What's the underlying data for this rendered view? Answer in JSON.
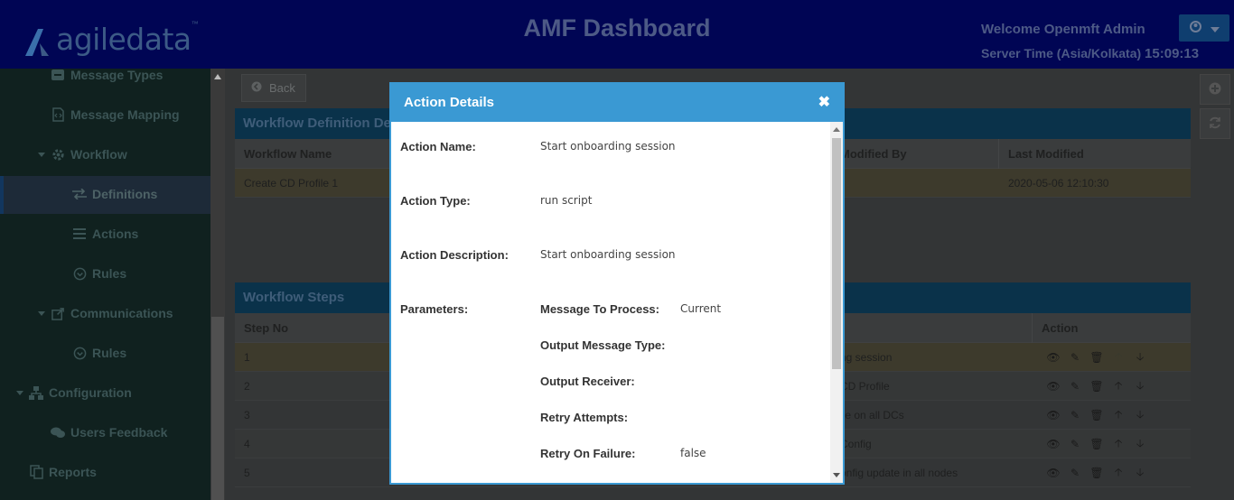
{
  "header": {
    "logo_text": "agiledata",
    "logo_tm": "™",
    "title": "AMF Dashboard",
    "welcome": "Welcome Openmft Admin",
    "server_time_label": "Server Time (Asia/Kolkata)",
    "server_time": "15:09:13",
    "user_icon": "user-circle-icon",
    "dropdown_icon": "caret-down-icon"
  },
  "sidebar": {
    "items": [
      {
        "label": "Message Types",
        "icon": "envelope-icon"
      },
      {
        "label": "Message Mapping",
        "icon": "code-file-icon"
      },
      {
        "label": "Workflow",
        "icon": "gear-icon"
      },
      {
        "label": "Definitions",
        "icon": "exchange-icon",
        "active": true
      },
      {
        "label": "Actions",
        "icon": "list-icon"
      },
      {
        "label": "Rules",
        "icon": "circle-arrow-icon"
      },
      {
        "label": "Communications",
        "icon": "share-icon"
      },
      {
        "label": "Rules",
        "icon": "circle-arrow-icon"
      },
      {
        "label": "Configuration",
        "icon": "sitemap-icon"
      },
      {
        "label": "Users Feedback",
        "icon": "comments-icon"
      },
      {
        "label": "Reports",
        "icon": "copy-icon"
      }
    ]
  },
  "main": {
    "back_label": "Back",
    "definition_panel_title": "Workflow Definition Details",
    "definition_headers": {
      "name": "Workflow Name",
      "modified_by": "Modified By",
      "last_modified": "Last Modified"
    },
    "definition_row": {
      "name": "Create CD Profile 1",
      "last_modified": "2020-05-06 12:10:30"
    },
    "steps_panel_title": "Workflow Steps",
    "steps_headers": {
      "step_no": "Step No",
      "action": "Action"
    },
    "steps": [
      {
        "no": "1",
        "desc_fragment": "ng session"
      },
      {
        "no": "2",
        "desc_fragment": "CD Profile"
      },
      {
        "no": "3",
        "desc_fragment": "ile on all DCs"
      },
      {
        "no": "4",
        "desc_fragment": "Config"
      },
      {
        "no": "5",
        "desc_fragment": "onfig update in all nodes"
      }
    ]
  },
  "modal": {
    "title": "Action Details",
    "close_symbol": "✖",
    "action_name_label": "Action Name:",
    "action_name": "Start onboarding session",
    "action_type_label": "Action Type:",
    "action_type": "run script",
    "action_desc_label": "Action Description:",
    "action_desc": "Start onboarding session",
    "parameters_label": "Parameters:",
    "parameters": [
      {
        "label": "Message To Process:",
        "value": "Current"
      },
      {
        "label": "Output Message Type:",
        "value": ""
      },
      {
        "label": "Output Receiver:",
        "value": ""
      },
      {
        "label": "Retry Attempts:",
        "value": ""
      },
      {
        "label": "Retry On Failure:",
        "value": "false"
      }
    ]
  },
  "colors": {
    "header_bg": "#000554",
    "modal_accent": "#3a99d3"
  }
}
